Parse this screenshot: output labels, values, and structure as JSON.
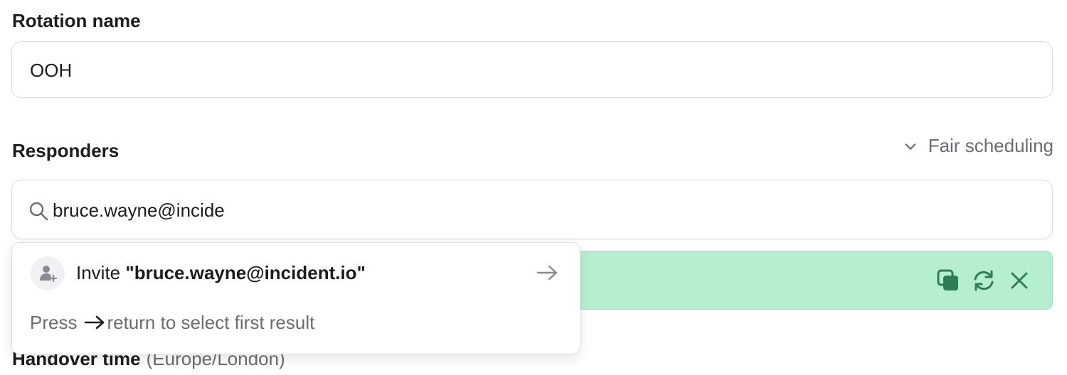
{
  "rotation": {
    "label": "Rotation name",
    "value": "OOH"
  },
  "responders": {
    "label": "Responders",
    "fair_scheduling_label": "Fair scheduling",
    "search_value": "bruce.wayne@incide"
  },
  "dropdown": {
    "invite_prefix": "Invite ",
    "invite_email": "\"bruce.wayne@incident.io\"",
    "hint_press": "Press",
    "hint_rest": "return to select first result"
  },
  "handover": {
    "label": "Handover time",
    "timezone": "(Europe/London)"
  },
  "colors": {
    "accent_green": "#b6efcf",
    "icon_green": "#2f7d56"
  },
  "icons": {
    "search": "search-icon",
    "chevron": "chevron-down-icon",
    "copy": "copy-icon",
    "refresh": "refresh-icon",
    "close": "close-icon",
    "invite": "user-plus-icon",
    "arrow": "arrow-right-icon"
  }
}
